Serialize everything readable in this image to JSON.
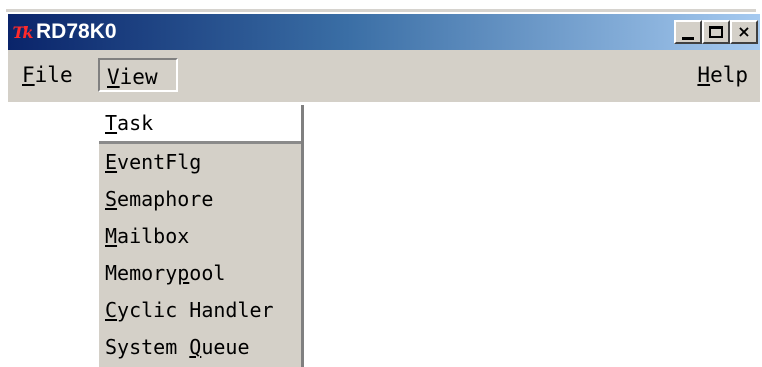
{
  "window": {
    "icon_text": "Tk",
    "title": "RD78K0",
    "buttons": {
      "minimize": "",
      "maximize": "",
      "close": "×"
    }
  },
  "menubar": {
    "file": {
      "hotkey": "F",
      "rest": "ile"
    },
    "view": {
      "hotkey": "V",
      "rest": "iew"
    },
    "help": {
      "hotkey": "H",
      "rest": "elp"
    }
  },
  "view_menu": {
    "items": [
      {
        "hotkey": "T",
        "rest": "ask"
      },
      {
        "hotkey": "E",
        "rest": "ventFlg"
      },
      {
        "hotkey": "S",
        "rest": "emaphore"
      },
      {
        "hotkey": "M",
        "rest": "ailbox"
      },
      {
        "pre": "Memory",
        "hotkey": "p",
        "rest": "ool"
      },
      {
        "hotkey": "C",
        "rest": "yclic Handler"
      },
      {
        "pre": "System ",
        "hotkey": "Q",
        "rest": "ueue"
      }
    ]
  },
  "colors": {
    "titlebar_start": "#0a246a",
    "titlebar_end": "#a6caf0",
    "face": "#d4d0c8",
    "icon": "#ff2a2a"
  }
}
